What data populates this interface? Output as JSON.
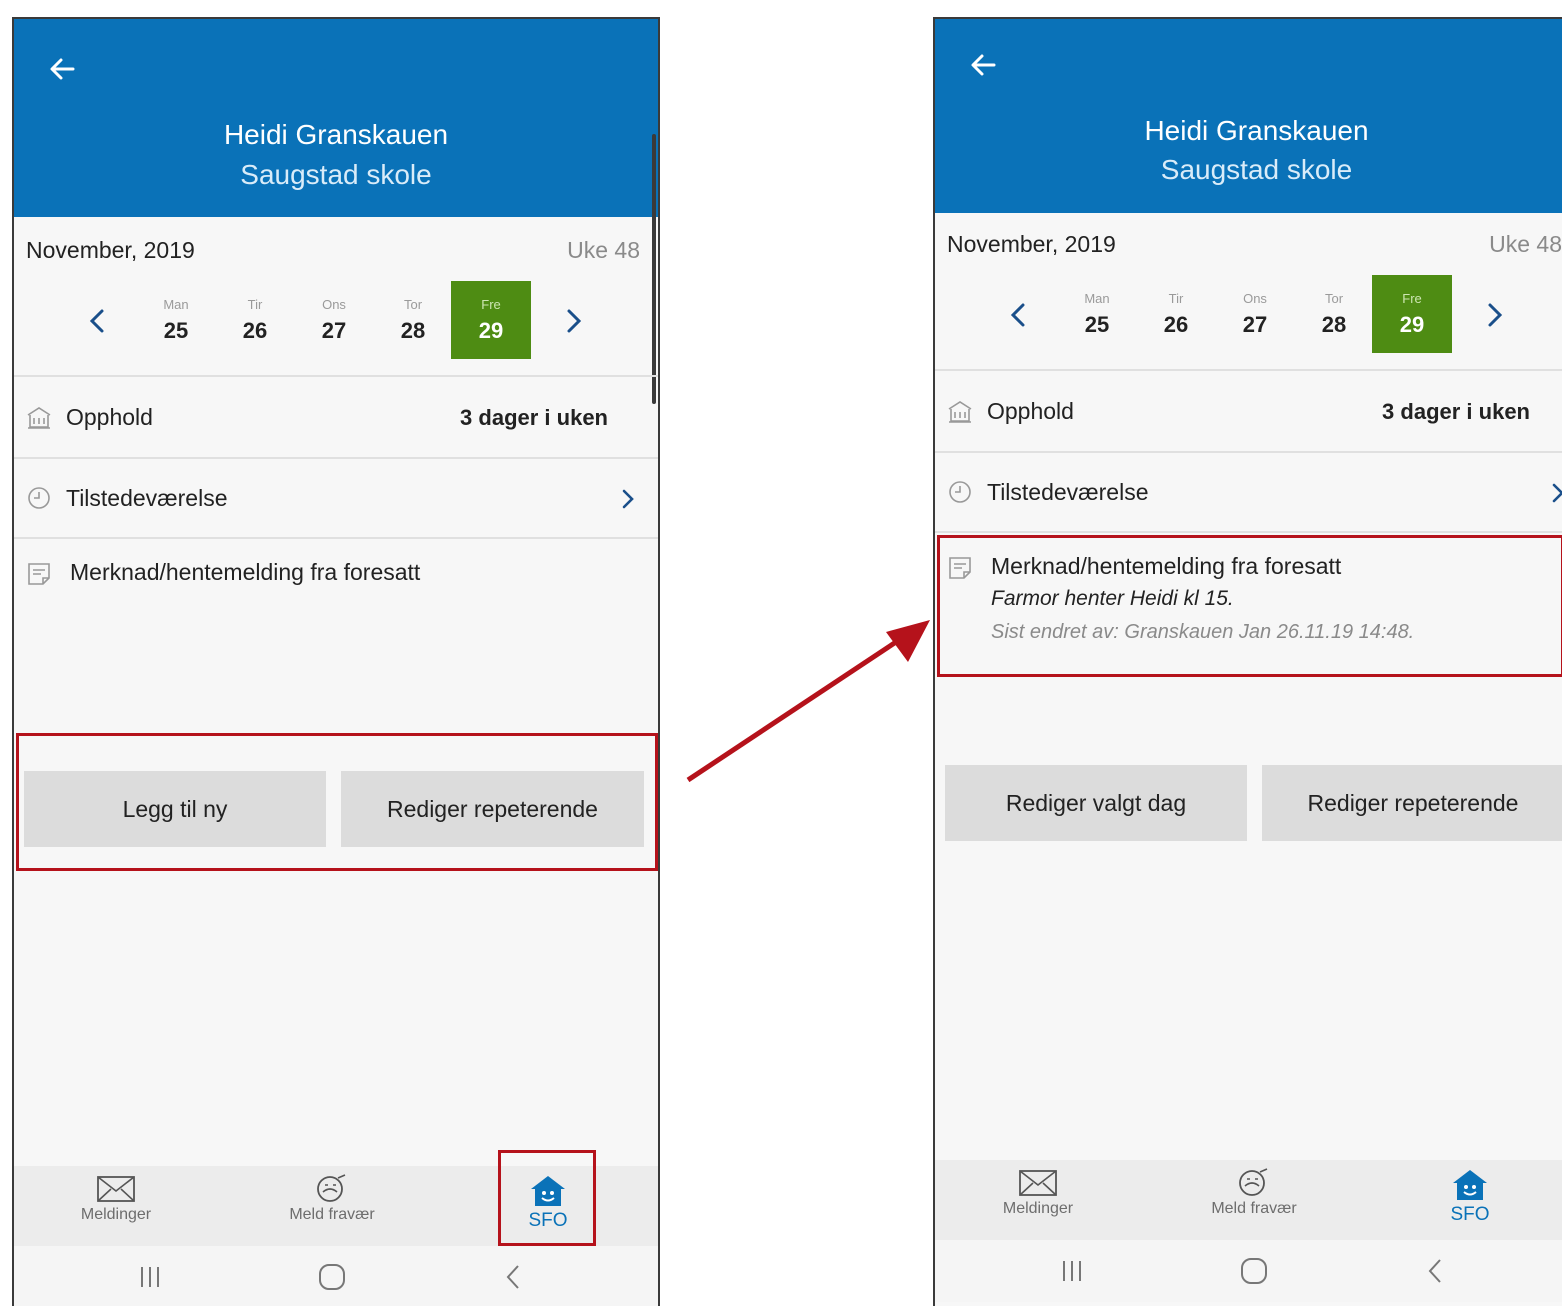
{
  "left": {
    "header": {
      "name": "Heidi Granskauen",
      "school": "Saugstad skole"
    },
    "calendar": {
      "month": "November, 2019",
      "week": "Uke 48",
      "days": [
        {
          "name": "Man",
          "date": "25"
        },
        {
          "name": "Tir",
          "date": "26"
        },
        {
          "name": "Ons",
          "date": "27"
        },
        {
          "name": "Tor",
          "date": "28"
        },
        {
          "name": "Fre",
          "date": "29",
          "selected": true
        }
      ]
    },
    "rows": {
      "opphold_label": "Opphold",
      "opphold_value": "3 dager i uken",
      "tilstede_label": "Tilstedeværelse",
      "merknad_label": "Merknad/hentemelding fra foresatt"
    },
    "buttons": {
      "primary": "Legg til ny",
      "secondary": "Rediger repeterende"
    },
    "tabs": {
      "meldinger": "Meldinger",
      "fravaer": "Meld fravær",
      "sfo": "SFO"
    }
  },
  "right": {
    "header": {
      "name": "Heidi Granskauen",
      "school": "Saugstad skole"
    },
    "calendar": {
      "month": "November, 2019",
      "week": "Uke 48",
      "days": [
        {
          "name": "Man",
          "date": "25"
        },
        {
          "name": "Tir",
          "date": "26"
        },
        {
          "name": "Ons",
          "date": "27"
        },
        {
          "name": "Tor",
          "date": "28"
        },
        {
          "name": "Fre",
          "date": "29",
          "selected": true
        }
      ]
    },
    "rows": {
      "opphold_label": "Opphold",
      "opphold_value": "3 dager i uken",
      "tilstede_label": "Tilstedeværelse",
      "merknad_label": "Merknad/hentemelding fra foresatt",
      "merknad_text": "Farmor henter Heidi kl 15.",
      "merknad_meta": "Sist endret av: Granskauen Jan 26.11.19 14:48."
    },
    "buttons": {
      "primary": "Rediger valgt dag",
      "secondary": "Rediger repeterende"
    },
    "tabs": {
      "meldinger": "Meldinger",
      "fravaer": "Meld fravær",
      "sfo": "SFO"
    }
  },
  "colors": {
    "header": "#0a72b8",
    "selected_day": "#4e8c13",
    "highlight": "#b5121b"
  },
  "icons": [
    "back-arrow-icon",
    "chevron-left-icon",
    "chevron-right-icon",
    "building-icon",
    "clock-icon",
    "note-icon",
    "mail-icon",
    "absence-icon",
    "sfo-house-icon",
    "recents-icon",
    "home-icon",
    "back-icon"
  ]
}
